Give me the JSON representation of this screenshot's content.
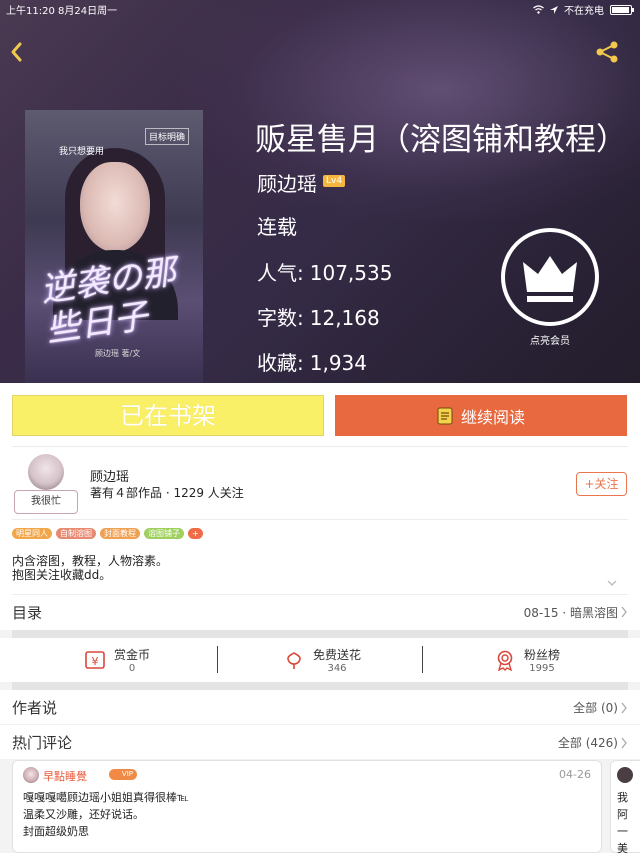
{
  "status_bar": {
    "time_date": "上午11:20  8月24日周一",
    "charging": "不在充电"
  },
  "book": {
    "cover_text_top": "我只想要用",
    "cover_text_right": "目标明确",
    "cover_title_art": "逆袭の那些日子",
    "cover_author_art": "顾边瑶 著/文",
    "title": "贩星售月（溶图铺和教程）",
    "author": "顾边瑶",
    "author_level": "Lv4",
    "status": "连载",
    "stats": [
      {
        "label": "人气:",
        "value": "107,535"
      },
      {
        "label": "字数:",
        "value": "12,168"
      },
      {
        "label": "收藏:",
        "value": "1,934"
      }
    ],
    "vip_label": "点亮会员"
  },
  "actions": {
    "shelf_label": "已在书架",
    "read_label": "继续阅读"
  },
  "author_info": {
    "busy": "我很忙",
    "name": "顾边瑶",
    "meta": "著有４部作品 · 1229 人关注",
    "follow_label": "+关注"
  },
  "tags": [
    {
      "label": "明星同人",
      "color": "#f2a64a"
    },
    {
      "label": "自制溶图",
      "color": "#e88a72"
    },
    {
      "label": "封面教程",
      "color": "#f0a052"
    },
    {
      "label": "溶图铺子",
      "color": "#9fcf5e"
    },
    {
      "label": "+",
      "color": "#ee6d48"
    }
  ],
  "intro": [
    "内含溶图，教程，人物溶素。",
    "抱图关注收藏dd。"
  ],
  "toc": {
    "title": "目录",
    "latest": "08-15 · 暗黑溶图"
  },
  "rewards": [
    {
      "label": "赏金币",
      "count": "0"
    },
    {
      "label": "免费送花",
      "count": "346"
    },
    {
      "label": "粉丝榜",
      "count": "1995"
    }
  ],
  "author_says": {
    "title": "作者说",
    "right": "全部 (0)"
  },
  "hot_comments": {
    "title": "热门评论",
    "right": "全部 (426)"
  },
  "comment": {
    "user": "早點睡覺",
    "vip": "VIP",
    "date": "04-26",
    "lines": [
      "嘎嘎嘎噶顾边瑶小姐姐真得很棒℡",
      "温柔又沙雕，还好说话。",
      "封面超级奶思"
    ]
  },
  "next_comment": {
    "lines": [
      "我",
      "阿",
      "一",
      "美"
    ]
  },
  "colors": {
    "accent_orange": "#e8693f",
    "shelf_yellow": "#faf068",
    "hero_bg": "#3b2c48"
  }
}
